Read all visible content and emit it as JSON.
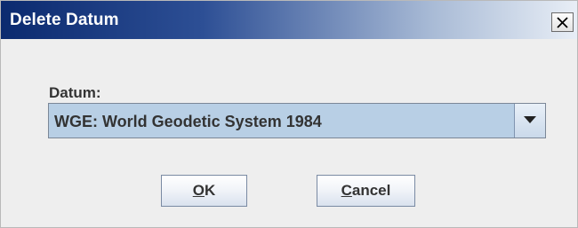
{
  "dialog": {
    "title": "Delete Datum",
    "close_glyph": "close-icon",
    "field_label": "Datum:",
    "datum_selected": "WGE: World Geodetic System 1984",
    "ok": {
      "mnemonic": "O",
      "rest": "K"
    },
    "cancel": {
      "mnemonic": "C",
      "rest": "ancel"
    }
  },
  "colors": {
    "titlebar_start": "#0b2a6f",
    "titlebar_end": "#e8eef6",
    "combo_bg": "#b8cfe5",
    "dialog_bg": "#eeeeee"
  }
}
